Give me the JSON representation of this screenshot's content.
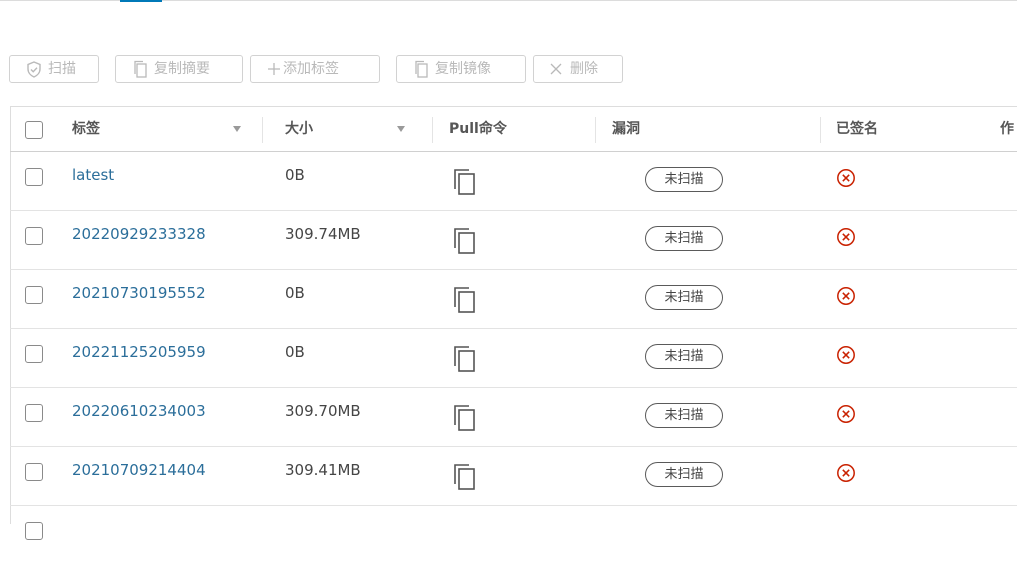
{
  "toolbar": {
    "scan": "扫描",
    "copy_digest": "复制摘要",
    "add_tag": "添加标签",
    "copy_image": "复制镜像",
    "delete": "删除"
  },
  "table": {
    "headers": {
      "tag": "标签",
      "size": "大小",
      "pull_command": "Pull命令",
      "vulnerabilities": "漏洞",
      "signed": "已签名",
      "author_partial": "作"
    },
    "rows": [
      {
        "tag": "latest",
        "size": "0B",
        "vuln_status": "未扫描"
      },
      {
        "tag": "20220929233328",
        "size": "309.74MB",
        "vuln_status": "未扫描"
      },
      {
        "tag": "20210730195552",
        "size": "0B",
        "vuln_status": "未扫描"
      },
      {
        "tag": "20221125205959",
        "size": "0B",
        "vuln_status": "未扫描"
      },
      {
        "tag": "20220610234003",
        "size": "309.70MB",
        "vuln_status": "未扫描"
      },
      {
        "tag": "20210709214404",
        "size": "309.41MB",
        "vuln_status": "未扫描"
      }
    ]
  },
  "colors": {
    "link": "#2b6e9a",
    "unsigned": "#c92100",
    "disabled_text": "#b9b9b9"
  }
}
